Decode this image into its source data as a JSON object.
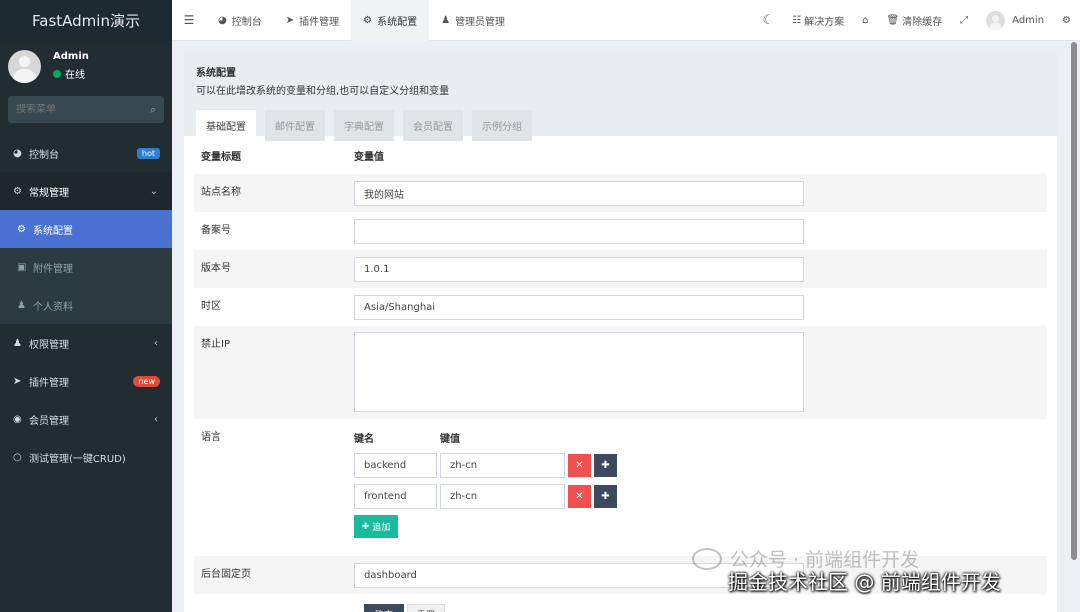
{
  "sidebar": {
    "logo": "FastAdmin演示",
    "user": {
      "name": "Admin",
      "status": "在线"
    },
    "search_placeholder": "搜索菜单",
    "items": [
      {
        "label": "控制台",
        "icon": "dashboard-icon",
        "badge": "hot"
      },
      {
        "label": "常规管理",
        "icon": "cogs-icon"
      },
      {
        "label": "系统配置",
        "icon": "gear-icon"
      },
      {
        "label": "附件管理",
        "icon": "image-icon"
      },
      {
        "label": "个人资料",
        "icon": "user-icon"
      },
      {
        "label": "权限管理",
        "icon": "group-icon"
      },
      {
        "label": "插件管理",
        "icon": "rocket-icon",
        "badge": "new"
      },
      {
        "label": "会员管理",
        "icon": "user-circle-icon"
      },
      {
        "label": "测试管理(一键CRUD)",
        "icon": "circle-icon"
      }
    ]
  },
  "topnav": {
    "tabs": [
      {
        "label": "控制台",
        "icon": "dashboard-icon"
      },
      {
        "label": "插件管理",
        "icon": "rocket-icon"
      },
      {
        "label": "系统配置",
        "icon": "gear-icon"
      },
      {
        "label": "管理员管理",
        "icon": "user-icon"
      }
    ],
    "solutions": "解决方案",
    "clear_cache": "清除缓存",
    "username": "Admin"
  },
  "panel": {
    "title": "系统配置",
    "description": "可以在此增改系统的变量和分组,也可以自定义分组和变量",
    "tabs": [
      "基础配置",
      "邮件配置",
      "字典配置",
      "会员配置",
      "示例分组"
    ],
    "col_title": "变量标题",
    "col_value": "变量值",
    "fields": {
      "site_name": {
        "label": "站点名称",
        "value": "我的网站"
      },
      "beian": {
        "label": "备案号",
        "value": ""
      },
      "version": {
        "label": "版本号",
        "value": "1.0.1"
      },
      "timezone": {
        "label": "时区",
        "value": "Asia/Shanghai"
      },
      "forbidden_ip": {
        "label": "禁止IP",
        "value": ""
      },
      "language": {
        "label": "语言",
        "key_header": "键名",
        "value_header": "键值",
        "rows": [
          {
            "key": "backend",
            "value": "zh-cn"
          },
          {
            "key": "frontend",
            "value": "zh-cn"
          }
        ],
        "add_label": "追加"
      },
      "fixed_page": {
        "label": "后台固定页",
        "value": "dashboard"
      }
    },
    "submit_label": "确定",
    "reset_label": "重置"
  },
  "watermark": {
    "text": "公众号 · 前端组件开发",
    "credit": "掘金技术社区 @ 前端组件开发"
  }
}
